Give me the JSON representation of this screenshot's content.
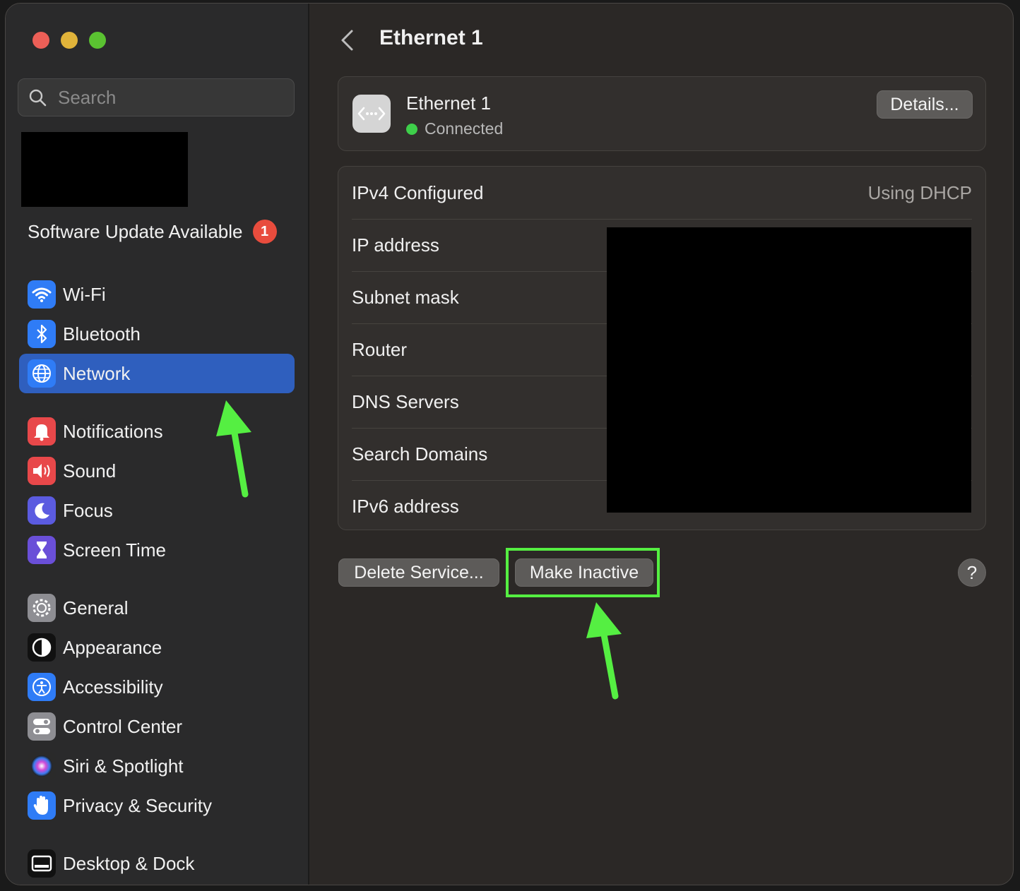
{
  "sidebar": {
    "search_placeholder": "Search",
    "update_label": "Software Update Available",
    "update_badge": "1",
    "items": [
      {
        "label": "Wi-Fi",
        "icon": "wifi-icon",
        "color": "#2f7cf6"
      },
      {
        "label": "Bluetooth",
        "icon": "bluetooth-icon",
        "color": "#2f7cf6"
      },
      {
        "label": "Network",
        "icon": "globe-icon",
        "color": "#2f7cf6",
        "selected": true
      },
      {
        "label": "Notifications",
        "icon": "bell-icon",
        "color": "#e8484a"
      },
      {
        "label": "Sound",
        "icon": "speaker-icon",
        "color": "#e8484a"
      },
      {
        "label": "Focus",
        "icon": "moon-icon",
        "color": "#5b5be0"
      },
      {
        "label": "Screen Time",
        "icon": "hourglass-icon",
        "color": "#6a4fd8"
      },
      {
        "label": "General",
        "icon": "gear-icon",
        "color": "#8e8e93"
      },
      {
        "label": "Appearance",
        "icon": "appearance-icon",
        "color": "#111111"
      },
      {
        "label": "Accessibility",
        "icon": "accessibility-icon",
        "color": "#2f7cf6"
      },
      {
        "label": "Control Center",
        "icon": "toggles-icon",
        "color": "#8e8e93"
      },
      {
        "label": "Siri & Spotlight",
        "icon": "siri-icon",
        "color": "#2a2a2a"
      },
      {
        "label": "Privacy & Security",
        "icon": "hand-icon",
        "color": "#2f7cf6"
      },
      {
        "label": "Desktop & Dock",
        "icon": "dock-icon",
        "color": "#111111"
      }
    ]
  },
  "main": {
    "title": "Ethernet 1",
    "service": {
      "name": "Ethernet 1",
      "status": "Connected",
      "status_color": "#3ecf4a",
      "details_label": "Details..."
    },
    "rows": [
      {
        "key": "IPv4 Configured",
        "value": "Using DHCP"
      },
      {
        "key": "IP address",
        "value": ""
      },
      {
        "key": "Subnet mask",
        "value": ""
      },
      {
        "key": "Router",
        "value": ""
      },
      {
        "key": "DNS Servers",
        "value": ""
      },
      {
        "key": "Search Domains",
        "value": ""
      },
      {
        "key": "IPv6 address",
        "value": ""
      }
    ],
    "delete_label": "Delete Service...",
    "inactive_label": "Make Inactive",
    "help_label": "?"
  },
  "annotation_color": "#55ef42"
}
